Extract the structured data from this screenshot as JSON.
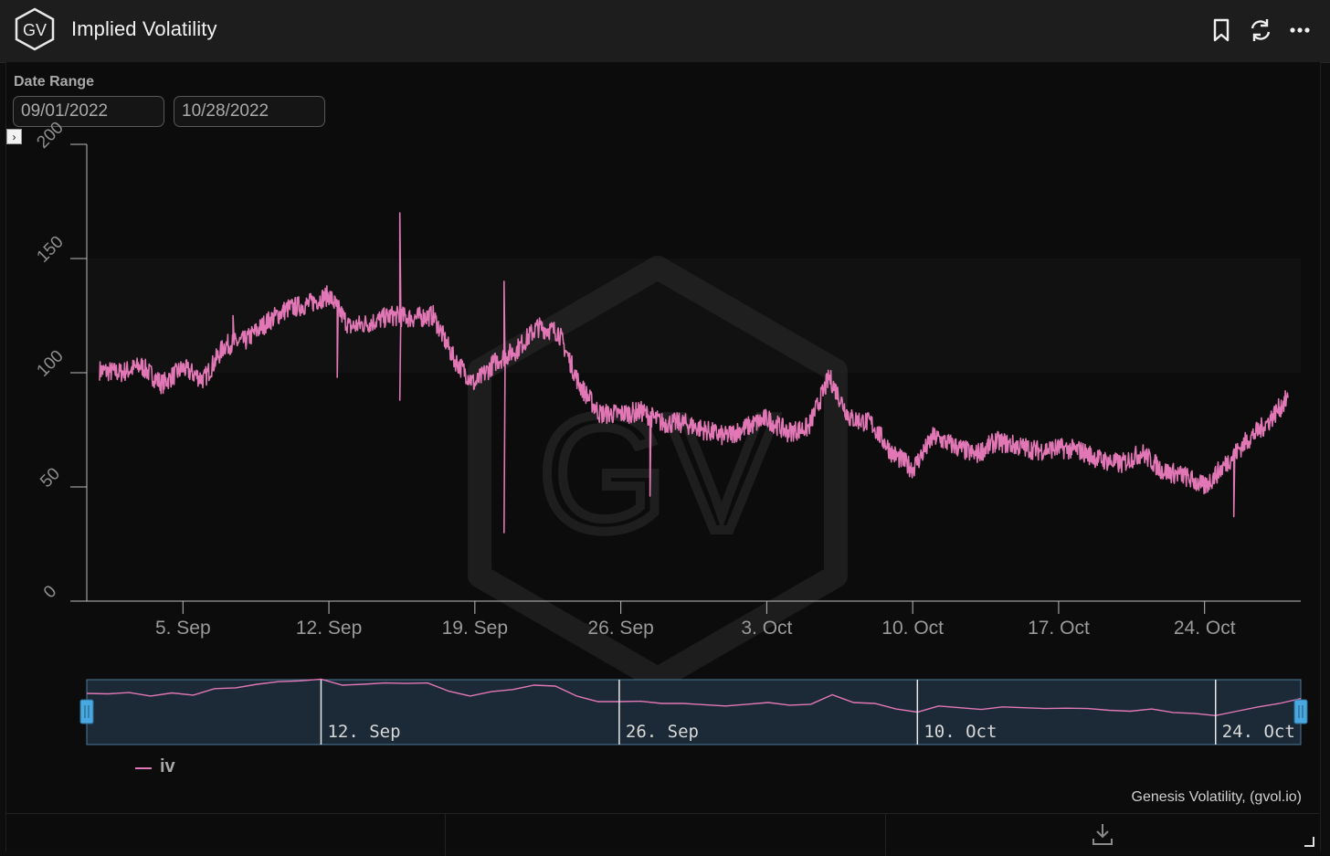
{
  "window": {
    "title": "Implied Volatility",
    "logo_text": "GV"
  },
  "toolbar": {
    "icons": [
      "bookmark-icon",
      "refresh-icon",
      "more-icon"
    ]
  },
  "date_range": {
    "label": "Date Range",
    "start": "09/01/2022",
    "end": "10/28/2022"
  },
  "watermark": {
    "text": "GV"
  },
  "credit": "Genesis Volatility, (gvol.io)",
  "legend": {
    "label": "iv"
  },
  "colors": {
    "series": "#e277b6",
    "navigator_fill": "#1b2a36",
    "navigator_border": "#4e7a99",
    "handle": "#4aa8e0"
  },
  "chart_data": {
    "type": "line",
    "series": [
      {
        "name": "iv",
        "points": [
          [
            "2022-09-01",
            101
          ],
          [
            "2022-09-02",
            100
          ],
          [
            "2022-09-03",
            103
          ],
          [
            "2022-09-04",
            95
          ],
          [
            "2022-09-05",
            102
          ],
          [
            "2022-09-06",
            97
          ],
          [
            "2022-09-07",
            112
          ],
          [
            "2022-09-08",
            114
          ],
          [
            "2022-09-09",
            122
          ],
          [
            "2022-09-10",
            128
          ],
          [
            "2022-09-11",
            130
          ],
          [
            "2022-09-12",
            134
          ],
          [
            "2022-09-13",
            120
          ],
          [
            "2022-09-14",
            122
          ],
          [
            "2022-09-15",
            125
          ],
          [
            "2022-09-16",
            124
          ],
          [
            "2022-09-17",
            125
          ],
          [
            "2022-09-18",
            106
          ],
          [
            "2022-09-19",
            95
          ],
          [
            "2022-09-20",
            105
          ],
          [
            "2022-09-21",
            110
          ],
          [
            "2022-09-22",
            120
          ],
          [
            "2022-09-23",
            118
          ],
          [
            "2022-09-24",
            95
          ],
          [
            "2022-09-25",
            82
          ],
          [
            "2022-09-26",
            82
          ],
          [
            "2022-09-27",
            83
          ],
          [
            "2022-09-28",
            78
          ],
          [
            "2022-09-29",
            78
          ],
          [
            "2022-09-30",
            75
          ],
          [
            "2022-10-01",
            72
          ],
          [
            "2022-10-02",
            76
          ],
          [
            "2022-10-03",
            80
          ],
          [
            "2022-10-04",
            74
          ],
          [
            "2022-10-05",
            76
          ],
          [
            "2022-10-06",
            98
          ],
          [
            "2022-10-07",
            80
          ],
          [
            "2022-10-08",
            78
          ],
          [
            "2022-10-09",
            65
          ],
          [
            "2022-10-10",
            58
          ],
          [
            "2022-10-11",
            72
          ],
          [
            "2022-10-12",
            68
          ],
          [
            "2022-10-13",
            64
          ],
          [
            "2022-10-14",
            70
          ],
          [
            "2022-10-15",
            68
          ],
          [
            "2022-10-16",
            66
          ],
          [
            "2022-10-17",
            67
          ],
          [
            "2022-10-18",
            66
          ],
          [
            "2022-10-19",
            62
          ],
          [
            "2022-10-20",
            60
          ],
          [
            "2022-10-21",
            65
          ],
          [
            "2022-10-22",
            57
          ],
          [
            "2022-10-23",
            55
          ],
          [
            "2022-10-24",
            50
          ],
          [
            "2022-10-25",
            60
          ],
          [
            "2022-10-26",
            70
          ],
          [
            "2022-10-27",
            78
          ],
          [
            "2022-10-28",
            89
          ]
        ],
        "spikes": [
          [
            "2022-09-07",
            125
          ],
          [
            "2022-09-12",
            98
          ],
          [
            "2022-09-15",
            170
          ],
          [
            "2022-09-15",
            88
          ],
          [
            "2022-09-20",
            140
          ],
          [
            "2022-09-20",
            30
          ],
          [
            "2022-09-27",
            46
          ],
          [
            "2022-10-25",
            37
          ],
          [
            "2022-10-28",
            94
          ]
        ]
      }
    ],
    "x_range": [
      "2022-09-01",
      "2022-10-28"
    ],
    "y_range": [
      0,
      200
    ],
    "y_ticks": [
      0,
      50,
      100,
      150,
      200
    ],
    "x_ticks": [
      {
        "date": "2022-09-05",
        "label": "5. Sep"
      },
      {
        "date": "2022-09-12",
        "label": "12. Sep"
      },
      {
        "date": "2022-09-19",
        "label": "19. Sep"
      },
      {
        "date": "2022-09-26",
        "label": "26. Sep"
      },
      {
        "date": "2022-10-03",
        "label": "3. Oct"
      },
      {
        "date": "2022-10-10",
        "label": "10. Oct"
      },
      {
        "date": "2022-10-17",
        "label": "17. Oct"
      },
      {
        "date": "2022-10-24",
        "label": "24. Oct"
      }
    ],
    "navigator_ticks": [
      {
        "date": "2022-09-12",
        "label": "12. Sep"
      },
      {
        "date": "2022-09-26",
        "label": "26. Sep"
      },
      {
        "date": "2022-10-10",
        "label": "10. Oct"
      },
      {
        "date": "2022-10-24",
        "label": "24. Oct"
      }
    ],
    "grid": true,
    "legend_position": "bottom-left"
  }
}
